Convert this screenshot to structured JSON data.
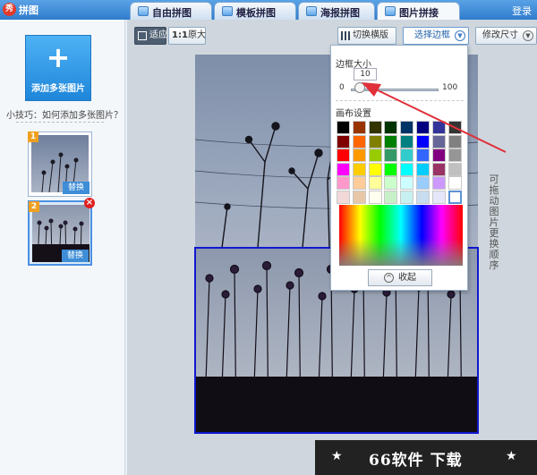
{
  "app": {
    "logo_char": "秀",
    "title": "拼图",
    "login_label": "登录"
  },
  "tabs": [
    {
      "label": "自由拼图",
      "active": false
    },
    {
      "label": "模板拼图",
      "active": false
    },
    {
      "label": "海报拼图",
      "active": false
    },
    {
      "label": "图片拼接",
      "active": true
    }
  ],
  "sidebar": {
    "add_button": {
      "plus": "+",
      "label": "添加多张图片"
    },
    "tip": "小技巧：如何添加多张图片？",
    "thumbnails": [
      {
        "badge": "1",
        "replace_label": "替换",
        "selected": false
      },
      {
        "badge": "2",
        "replace_label": "替换",
        "selected": true,
        "close": "×"
      }
    ]
  },
  "toolbar": {
    "fit_label": "适应",
    "original_label": "原大",
    "original_prefix": "1:1",
    "switch_label": "切换横版",
    "border_label": "选择边框",
    "size_label": "修改尺寸"
  },
  "border_panel": {
    "title": "边框大小",
    "value": "10",
    "min": "0",
    "max": "100",
    "slider_fraction": 0.1,
    "canvas_title": "画布设置",
    "swatches": [
      [
        "#000000",
        "#993300",
        "#333300",
        "#003300",
        "#003366",
        "#000080",
        "#333399",
        "#333333"
      ],
      [
        "#800000",
        "#ff6600",
        "#808000",
        "#008000",
        "#008080",
        "#0000ff",
        "#666699",
        "#808080"
      ],
      [
        "#ff0000",
        "#ff9900",
        "#99cc00",
        "#339966",
        "#33cccc",
        "#3366ff",
        "#800080",
        "#969696"
      ],
      [
        "#ff00ff",
        "#ffcc00",
        "#ffff00",
        "#00ff00",
        "#00ffff",
        "#00ccff",
        "#993366",
        "#c0c0c0"
      ],
      [
        "#ff99cc",
        "#ffcc99",
        "#ffff99",
        "#ccffcc",
        "#ccffff",
        "#99ccff",
        "#cc99ff",
        "#ffffff"
      ],
      [
        "#f2d9d9",
        "#e6c8a8",
        "#fffff0",
        "#c8f0c8",
        "#c8f0f0",
        "#c8dcf0",
        "#e6e6fa",
        "#ffffff"
      ]
    ],
    "selected_swatch": [
      5,
      7
    ],
    "collapse_label": "收起"
  },
  "hint_vertical": "可拖动图片更换顺序",
  "watermark": {
    "text": "66软件 下载",
    "star": "★"
  },
  "colors": {
    "accent": "#2f7ccc",
    "selection": "#1018d0",
    "arrow": "#e0303a"
  }
}
